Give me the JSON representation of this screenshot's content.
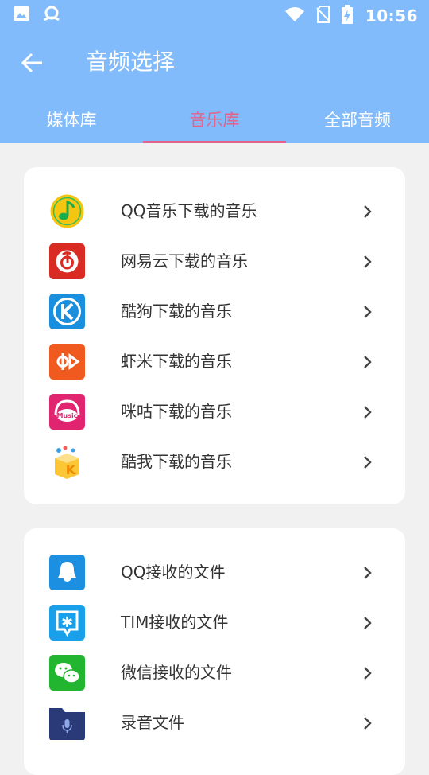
{
  "status_bar": {
    "time": "10:56",
    "left_icons": [
      "image-icon",
      "app-notification-icon"
    ],
    "right_icons": [
      "wifi-icon",
      "no-sim-icon",
      "battery-charging-icon"
    ]
  },
  "toolbar": {
    "back_icon": "arrow-left-icon",
    "title": "音频选择"
  },
  "tabs": [
    {
      "label": "媒体库",
      "active": false
    },
    {
      "label": "音乐库",
      "active": true
    },
    {
      "label": "全部音频",
      "active": false
    }
  ],
  "music_sources": [
    {
      "label": "QQ音乐下载的音乐",
      "icon": "qq-music-icon"
    },
    {
      "label": "网易云下载的音乐",
      "icon": "netease-cloud-music-icon"
    },
    {
      "label": "酷狗下载的音乐",
      "icon": "kugou-icon"
    },
    {
      "label": "虾米下载的音乐",
      "icon": "xiami-icon"
    },
    {
      "label": "咪咕下载的音乐",
      "icon": "migu-icon"
    },
    {
      "label": "酷我下载的音乐",
      "icon": "kuwo-icon"
    }
  ],
  "file_sources": [
    {
      "label": "QQ接收的文件",
      "icon": "qq-icon"
    },
    {
      "label": "TIM接收的文件",
      "icon": "tim-icon"
    },
    {
      "label": "微信接收的文件",
      "icon": "wechat-icon"
    },
    {
      "label": "录音文件",
      "icon": "recording-folder-icon"
    }
  ],
  "colors": {
    "header": "#82bbfb",
    "active_tab": "#e4628a",
    "background": "#f1f1f1"
  }
}
